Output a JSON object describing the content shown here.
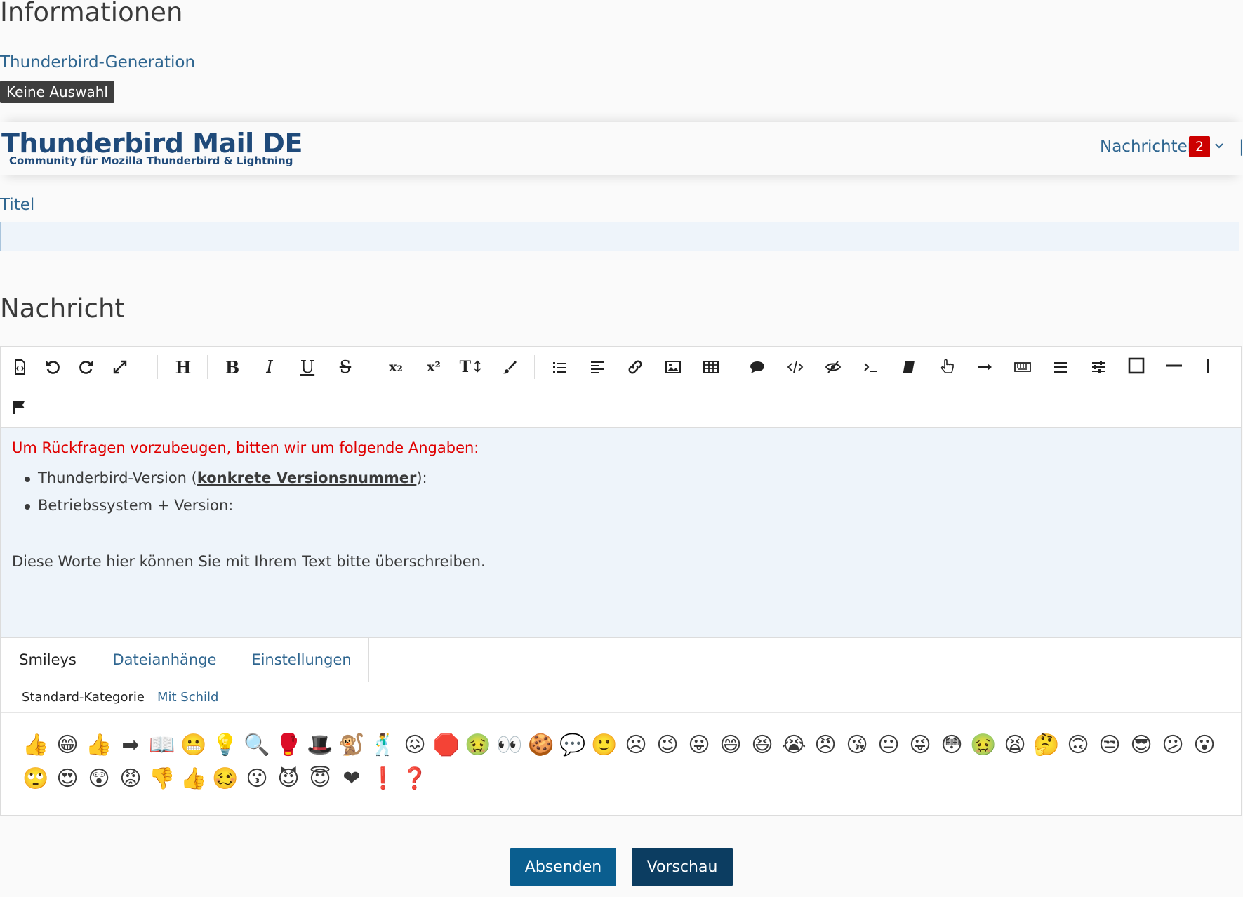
{
  "info": {
    "heading": "Informationen",
    "generation_label": "Thunderbird-Generation",
    "generation_value": "Keine Auswahl"
  },
  "header": {
    "logo_title": "Thunderbird Mail DE",
    "logo_subtitle": "Community für Mozilla Thunderbird & Lightning",
    "nav_messages": "Nachrichten",
    "nav_badge": "2"
  },
  "form": {
    "title_label": "Titel",
    "title_value": "",
    "message_heading": "Nachricht"
  },
  "toolbar": {
    "icons": [
      "source-code-icon",
      "undo-icon",
      "redo-icon",
      "fullscreen-icon",
      "heading-icon",
      "bold-icon",
      "italic-icon",
      "underline-icon",
      "strikethrough-icon",
      "subscript-icon",
      "superscript-icon",
      "font-size-icon",
      "color-brush-icon",
      "list-icon",
      "align-icon",
      "link-icon",
      "image-icon",
      "table-icon",
      "quote-icon",
      "code-icon",
      "spoiler-icon",
      "tt-icon",
      "wiki-icon",
      "pointer-icon",
      "arrow-icon",
      "keyboard-icon",
      "menu-icon",
      "sliders-icon",
      "box-icon",
      "horizontal-line-icon",
      "vertical-line-icon",
      "flag-icon"
    ],
    "heading_label": "H",
    "bold_label": "B",
    "italic_label": "I",
    "underline_label": "U",
    "strike_label": "S",
    "sub_label": "x₂",
    "sup_label": "x²",
    "fontsize_label": "T↕"
  },
  "content": {
    "hint": "Um Rückfragen vorzubeugen, bitten wir um folgende Angaben:",
    "item1_prefix": "Thunderbird-Version (",
    "item1_link": "konkrete Versionsnummer",
    "item1_suffix": "):",
    "item2": "Betriebssystem + Version:",
    "overwrite": "Diese Worte hier können Sie mit Ihrem Text bitte überschreiben."
  },
  "tabs": {
    "smileys": "Smileys",
    "attachments": "Dateianhänge",
    "settings": "Einstellungen"
  },
  "subtabs": {
    "standard": "Standard-Kategorie",
    "shield": "Mit Schild"
  },
  "smileys_row1": [
    "👍",
    "😁",
    "👍",
    "➡",
    "📖",
    "😬",
    "💡",
    "🔍",
    "🥊",
    "🎩",
    "🐒",
    "🕺",
    "😖",
    "🛑",
    "🤢",
    "👀",
    "🍪",
    "💬",
    "🙂",
    "☹",
    "😉",
    "😛",
    "😄",
    "😆",
    "😭",
    "😠",
    "😘",
    "😐",
    "😜",
    "😳",
    "🤢",
    "😫",
    "🤔",
    "🙃",
    "😒",
    "😎",
    "😕",
    "😮"
  ],
  "smileys_row2": [
    "🙄",
    "😍",
    "😲",
    "😡",
    "👎",
    "👍",
    "🥴",
    "😗",
    "😈",
    "😇",
    "❤",
    "❗",
    "❓"
  ],
  "buttons": {
    "send": "Absenden",
    "preview": "Vorschau"
  }
}
